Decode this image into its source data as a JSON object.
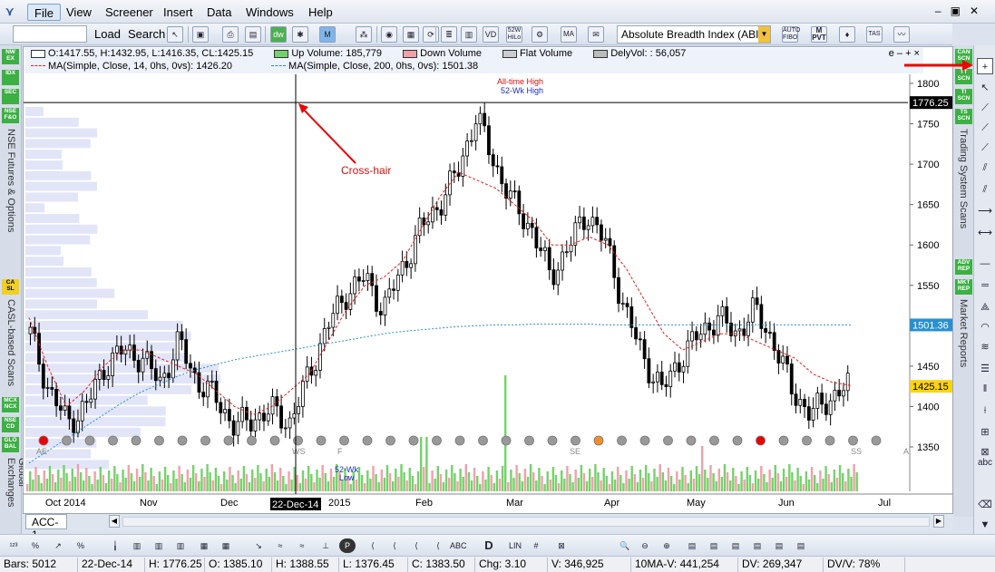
{
  "menu": {
    "items": [
      "File",
      "View",
      "Screener",
      "Insert",
      "Data",
      "Windows",
      "Help"
    ],
    "active": "File"
  },
  "toolbar": {
    "load_label": "Load",
    "search_label": "Search",
    "scan_select_value": "Absolute Breadth Index (ABI",
    "icons": [
      "dw-icon",
      "hash-icon",
      "ma-icon",
      "fv-icon",
      "vd-icon",
      "52wk-hilo-icon",
      "auto-fibo-icon",
      "m-pvt-icon",
      "tas-icon"
    ]
  },
  "left_strip": {
    "buttons": [
      "NW EX",
      "IDX",
      "SEC",
      "NSE F&O",
      "CA SL",
      "MCX NCX",
      "NSE CD",
      "GLO BAL"
    ],
    "panels": [
      "NSE Futures & Options",
      "CASL-based Scans",
      "Global Exchanges"
    ]
  },
  "right_strip": {
    "buttons": [
      "CAN SCN",
      "TT SCN",
      "TI SCN",
      "TS SCN",
      "ADV REP",
      "MKT REP"
    ],
    "panels": [
      "Trading System Scans",
      "Market Reports"
    ]
  },
  "legend": {
    "ohlc": "O:1417.55, H:1432.95, L:1416.35, CL:1425.15",
    "up_volume": "Up Volume: 185,779",
    "down_volume": "Down Volume",
    "flat_volume": "Flat Volume",
    "dely_vol": "DelyVol: : 56,057",
    "ma14": "MA(Simple, Close, 14, 0hs, 0vs): 1426.20",
    "ma200": "MA(Simple, Close, 200, 0hs, 0vs): 1501.38",
    "window_controls": "e – +  ×",
    "colors": {
      "up": "#74d26a",
      "down": "#f2a0a8",
      "flat": "#cccccc",
      "ma14": "#e02020",
      "ma200": "#2a8fcf"
    }
  },
  "annotations": {
    "all_time_high": "All-time High",
    "wk52_high": "52-Wk High",
    "crosshair_label": "Cross-hair",
    "wk52_low": "52-Wk\nLow",
    "crosshair_value": "1776.25",
    "crosshair_date": "22-Dec-14",
    "last_price": "1425.15",
    "ma200_value": "1501.36",
    "event_labels": [
      "AE",
      "WS",
      "F",
      "SE",
      "SS",
      "A"
    ]
  },
  "chart_data": {
    "type": "candlestick",
    "symbol": "ACC-1",
    "y_ticks": [
      1350,
      1400,
      1450,
      1500,
      1550,
      1600,
      1650,
      1700,
      1750,
      1800
    ],
    "ylim": [
      1320,
      1815
    ],
    "x_labels": [
      "Oct 2014",
      "Nov",
      "Dec",
      "2015",
      "Feb",
      "Mar",
      "Apr",
      "May",
      "Jun",
      "Jul"
    ],
    "series": [
      {
        "name": "Close (weekly sampled)",
        "values": [
          1490,
          1420,
          1380,
          1400,
          1450,
          1470,
          1460,
          1430,
          1480,
          1430,
          1410,
          1375,
          1385,
          1395,
          1380,
          1440,
          1500,
          1540,
          1560,
          1520,
          1570,
          1620,
          1650,
          1690,
          1760,
          1700,
          1650,
          1620,
          1560,
          1600,
          1640,
          1600,
          1520,
          1460,
          1420,
          1460,
          1490,
          1510,
          1490,
          1520,
          1480,
          1420,
          1390,
          1410,
          1425
        ]
      },
      {
        "name": "MA(14)",
        "values": [
          1510,
          1450,
          1400,
          1420,
          1450,
          1470,
          1470,
          1460,
          1450,
          1440,
          1420,
          1400,
          1390,
          1400,
          1420,
          1440,
          1480,
          1520,
          1550,
          1560,
          1580,
          1620,
          1660,
          1690,
          1680,
          1670,
          1650,
          1630,
          1600,
          1600,
          1610,
          1600,
          1570,
          1530,
          1490,
          1470,
          1480,
          1490,
          1490,
          1480,
          1470,
          1460,
          1440,
          1430,
          1426
        ]
      },
      {
        "name": "MA(200)",
        "values": [
          1330,
          1345,
          1360,
          1375,
          1390,
          1405,
          1418,
          1428,
          1438,
          1446,
          1452,
          1458,
          1462,
          1466,
          1470,
          1474,
          1478,
          1482,
          1486,
          1490,
          1493,
          1495,
          1497,
          1499,
          1500,
          1501,
          1501,
          1502,
          1502,
          1502,
          1502,
          1501,
          1501,
          1501,
          1501,
          1501,
          1501,
          1501,
          1501,
          1501,
          1501,
          1501,
          1501,
          1501,
          1501
        ]
      }
    ]
  },
  "tab": {
    "label": "ACC-1"
  },
  "status": {
    "bars": "Bars: 5012",
    "date": "22-Dec-14",
    "h_cross": "H: 1776.25",
    "open": "O: 1385.10",
    "high": "H: 1388.55",
    "low": "L: 1376.45",
    "close": "C: 1383.50",
    "chg": "Chg: 3.10",
    "vol": "V: 346,925",
    "ma_vol": "10MA-V: 441,254",
    "dv": "DV: 269,347",
    "dvv": "DV/V: 78%"
  },
  "bottom_tools": {
    "lin_label": "LIN"
  }
}
